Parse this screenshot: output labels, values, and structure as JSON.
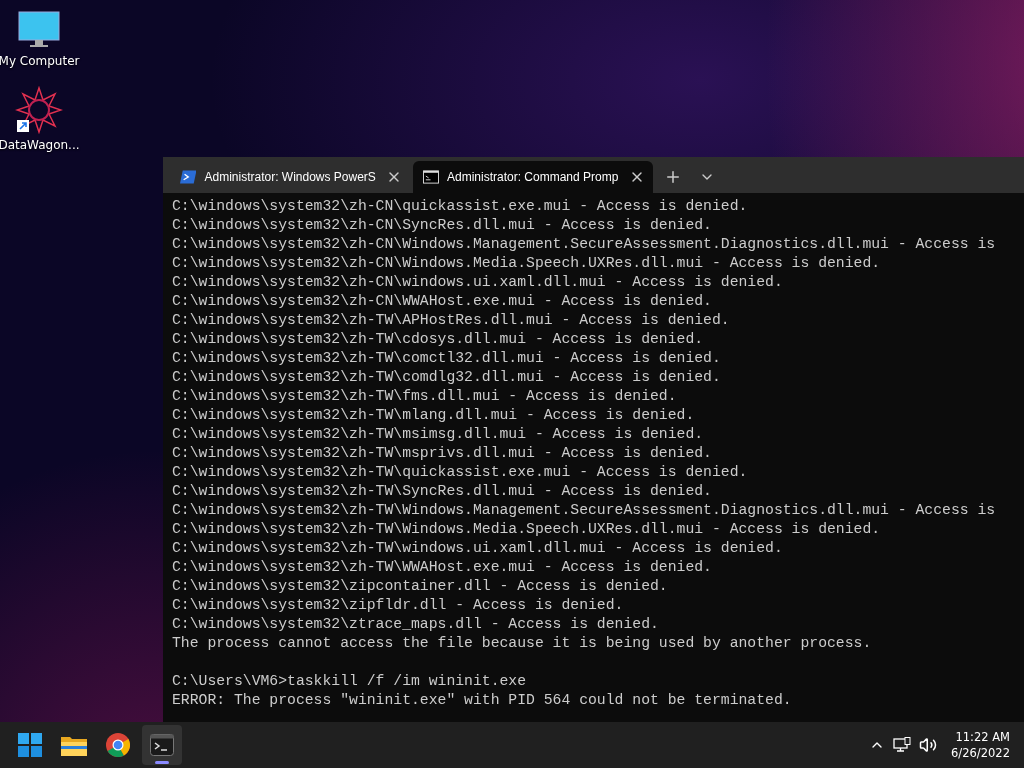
{
  "desktop_icons": [
    {
      "label": "My Computer",
      "kind": "computer"
    },
    {
      "label": "DataWagon...",
      "kind": "shortcut"
    }
  ],
  "terminal": {
    "tabs": [
      {
        "title": "Administrator: Windows PowerS",
        "kind": "powershell",
        "selected": false
      },
      {
        "title": "Administrator: Command Promp",
        "kind": "cmd",
        "selected": true
      }
    ],
    "sections": [
      {
        "lines": [
          "C:\\windows\\system32\\zh-CN\\quickassist.exe.mui - Access is denied.",
          "C:\\windows\\system32\\zh-CN\\SyncRes.dll.mui - Access is denied.",
          "C:\\windows\\system32\\zh-CN\\Windows.Management.SecureAssessment.Diagnostics.dll.mui - Access is",
          "C:\\windows\\system32\\zh-CN\\Windows.Media.Speech.UXRes.dll.mui - Access is denied.",
          "C:\\windows\\system32\\zh-CN\\windows.ui.xaml.dll.mui - Access is denied.",
          "C:\\windows\\system32\\zh-CN\\WWAHost.exe.mui - Access is denied.",
          "C:\\windows\\system32\\zh-TW\\APHostRes.dll.mui - Access is denied.",
          "C:\\windows\\system32\\zh-TW\\cdosys.dll.mui - Access is denied.",
          "C:\\windows\\system32\\zh-TW\\comctl32.dll.mui - Access is denied.",
          "C:\\windows\\system32\\zh-TW\\comdlg32.dll.mui - Access is denied.",
          "C:\\windows\\system32\\zh-TW\\fms.dll.mui - Access is denied.",
          "C:\\windows\\system32\\zh-TW\\mlang.dll.mui - Access is denied.",
          "C:\\windows\\system32\\zh-TW\\msimsg.dll.mui - Access is denied.",
          "C:\\windows\\system32\\zh-TW\\msprivs.dll.mui - Access is denied.",
          "C:\\windows\\system32\\zh-TW\\quickassist.exe.mui - Access is denied.",
          "C:\\windows\\system32\\zh-TW\\SyncRes.dll.mui - Access is denied.",
          "C:\\windows\\system32\\zh-TW\\Windows.Management.SecureAssessment.Diagnostics.dll.mui - Access is",
          "C:\\windows\\system32\\zh-TW\\Windows.Media.Speech.UXRes.dll.mui - Access is denied.",
          "C:\\windows\\system32\\zh-TW\\windows.ui.xaml.dll.mui - Access is denied.",
          "C:\\windows\\system32\\zh-TW\\WWAHost.exe.mui - Access is denied.",
          "C:\\windows\\system32\\zipcontainer.dll - Access is denied.",
          "C:\\windows\\system32\\zipfldr.dll - Access is denied.",
          "C:\\windows\\system32\\ztrace_maps.dll - Access is denied.",
          "The process cannot access the file because it is being used by another process."
        ]
      },
      {
        "lines": [
          "C:\\Users\\VM6>taskkill /f /im wininit.exe",
          "ERROR: The process \"wininit.exe\" with PID 564 could not be terminated."
        ]
      }
    ]
  },
  "taskbar": {
    "apps": [
      {
        "kind": "start",
        "selected": false
      },
      {
        "kind": "explorer",
        "selected": false
      },
      {
        "kind": "browser",
        "selected": false
      },
      {
        "kind": "terminal",
        "selected": true
      }
    ],
    "clock": {
      "time": "11:22 AM",
      "date": "6/26/2022"
    }
  }
}
